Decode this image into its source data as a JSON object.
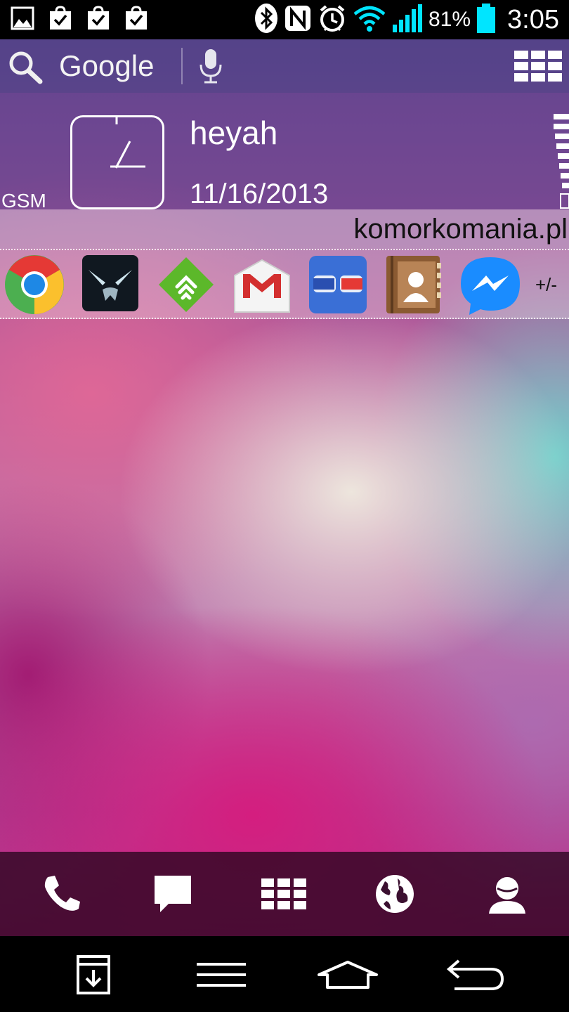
{
  "status_bar": {
    "left_icons": [
      "image-notification-icon",
      "shopping-bag-check-icon",
      "shopping-bag-check-icon",
      "shopping-bag-check-icon"
    ],
    "right_icons": [
      "bluetooth-icon",
      "nfc-icon",
      "alarm-icon",
      "wifi-icon",
      "cell-signal-icon"
    ],
    "battery_percent": "81%",
    "battery_level": 0.81,
    "time": "3:05"
  },
  "search_bar": {
    "label": "Google",
    "icons": [
      "search-icon",
      "microphone-icon",
      "app-grid-icon"
    ]
  },
  "clock_widget": {
    "network_type": "GSM",
    "carrier": "heyah",
    "date": "11/16/2013",
    "icons": [
      "analog-clock-icon",
      "signal-bars-icon"
    ]
  },
  "banner": {
    "text": "komorkomania.pl"
  },
  "app_shortcuts": {
    "apps": [
      "chrome-icon",
      "falcon-twitter-icon",
      "feedly-icon",
      "gmail-icon",
      "goggles-icon",
      "contacts-book-icon",
      "messenger-icon"
    ],
    "edit_label": "+/-"
  },
  "dock": {
    "items": [
      "phone-icon",
      "messaging-icon",
      "apps-drawer-icon",
      "browser-globe-icon",
      "contacts-icon"
    ]
  },
  "nav_bar": {
    "items": [
      "notification-download-icon",
      "menu-icon",
      "home-icon",
      "back-icon"
    ]
  },
  "colors": {
    "status_bar": "#000000",
    "battery_fill": "#00e5ff",
    "wifi_signal": "#00e5ff",
    "gmail_red": "#d32f2f",
    "feedly_green": "#5cb82a",
    "messenger_blue": "#1a8cff"
  }
}
